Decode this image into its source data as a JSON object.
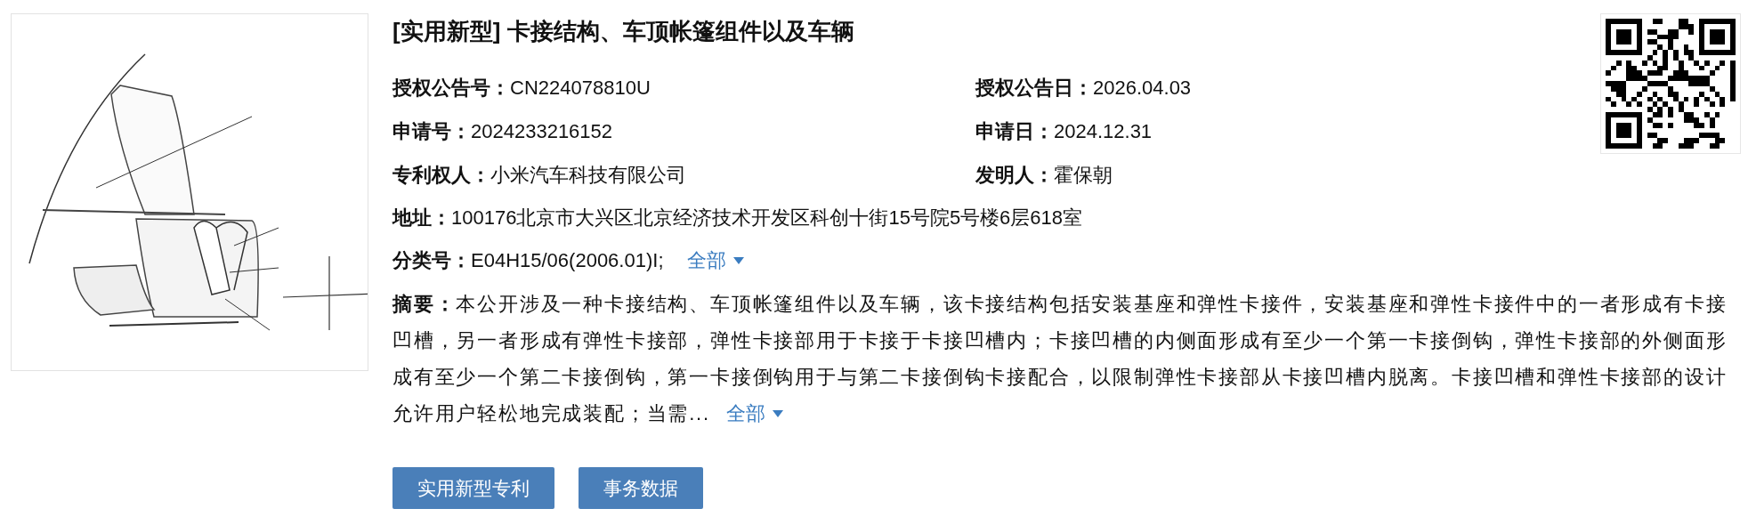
{
  "title": "[实用新型] 卡接结构、车顶帐篷组件以及车辆",
  "info_rows": [
    {
      "kind": "pair",
      "cells": [
        {
          "label": "授权公告号：",
          "value": "CN224078810U"
        },
        {
          "label": "授权公告日：",
          "value": "2026.04.03"
        }
      ]
    },
    {
      "kind": "pair",
      "cells": [
        {
          "label": "申请号：",
          "value": "2024233216152"
        },
        {
          "label": "申请日：",
          "value": "2024.12.31"
        }
      ]
    },
    {
      "kind": "pair",
      "cells": [
        {
          "label": "专利权人：",
          "value": "小米汽车科技有限公司"
        },
        {
          "label": "发明人：",
          "value": "霍保朝"
        }
      ]
    },
    {
      "kind": "single",
      "label": "地址：",
      "value": "100176北京市大兴区北京经济技术开发区科创十街15号院5号楼6层618室"
    },
    {
      "kind": "expandable",
      "label": "分类号：",
      "value": "E04H15/06(2006.01)I;",
      "link": "全部"
    }
  ],
  "abstract": {
    "text": "**摘要：**本公开涉及一种卡接结构、车顶帐篷组件以及车辆，该卡接结构包括安装基座和弹性卡接件，安装基座和弹性卡接件中的一者形成有卡接凹槽，另一者形成有弹性卡接部，弹性卡接部用于卡接于卡接凹槽内；卡接凹槽的内侧面形成有至少一个第一卡接倒钩，弹性卡接部的外侧面形成有至少一个第二卡接倒钩，第一卡接倒钩用于与第二卡接倒钩卡接配合，以限制弹性卡接部从卡接凹槽内脱离。卡接凹槽和弹性卡接部的设计允许用户轻松地完成装配；当需...",
    "link": "全部"
  },
  "buttons": [
    "实用新型专利",
    "事务数据"
  ]
}
